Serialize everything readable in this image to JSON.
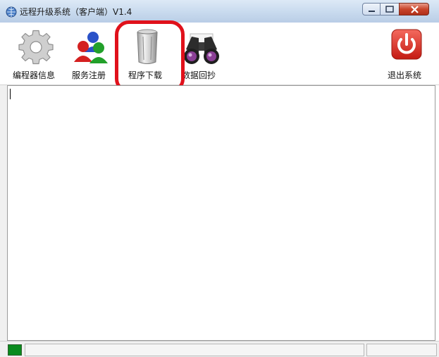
{
  "window": {
    "title": "远程升级系统（客户端）V1.4",
    "icons": {
      "app": "app-globe-icon",
      "minimize": "minimize-icon",
      "maximize": "maximize-icon",
      "close": "close-icon"
    }
  },
  "toolbar": {
    "items": [
      {
        "label": "编程器信息",
        "icon": "gear-icon"
      },
      {
        "label": "服务注册",
        "icon": "users-icon"
      },
      {
        "label": "程序下载",
        "icon": "trash-can-icon"
      },
      {
        "label": "数据回抄",
        "icon": "binoculars-icon"
      },
      {
        "label": "退出系统",
        "icon": "power-icon"
      }
    ]
  },
  "content": {
    "text": ""
  },
  "status": {
    "indicator_color": "#0a8a1e",
    "panes": [
      "",
      ""
    ]
  },
  "colors": {
    "highlight": "#e0111b",
    "exit_button": "#e0322a"
  }
}
